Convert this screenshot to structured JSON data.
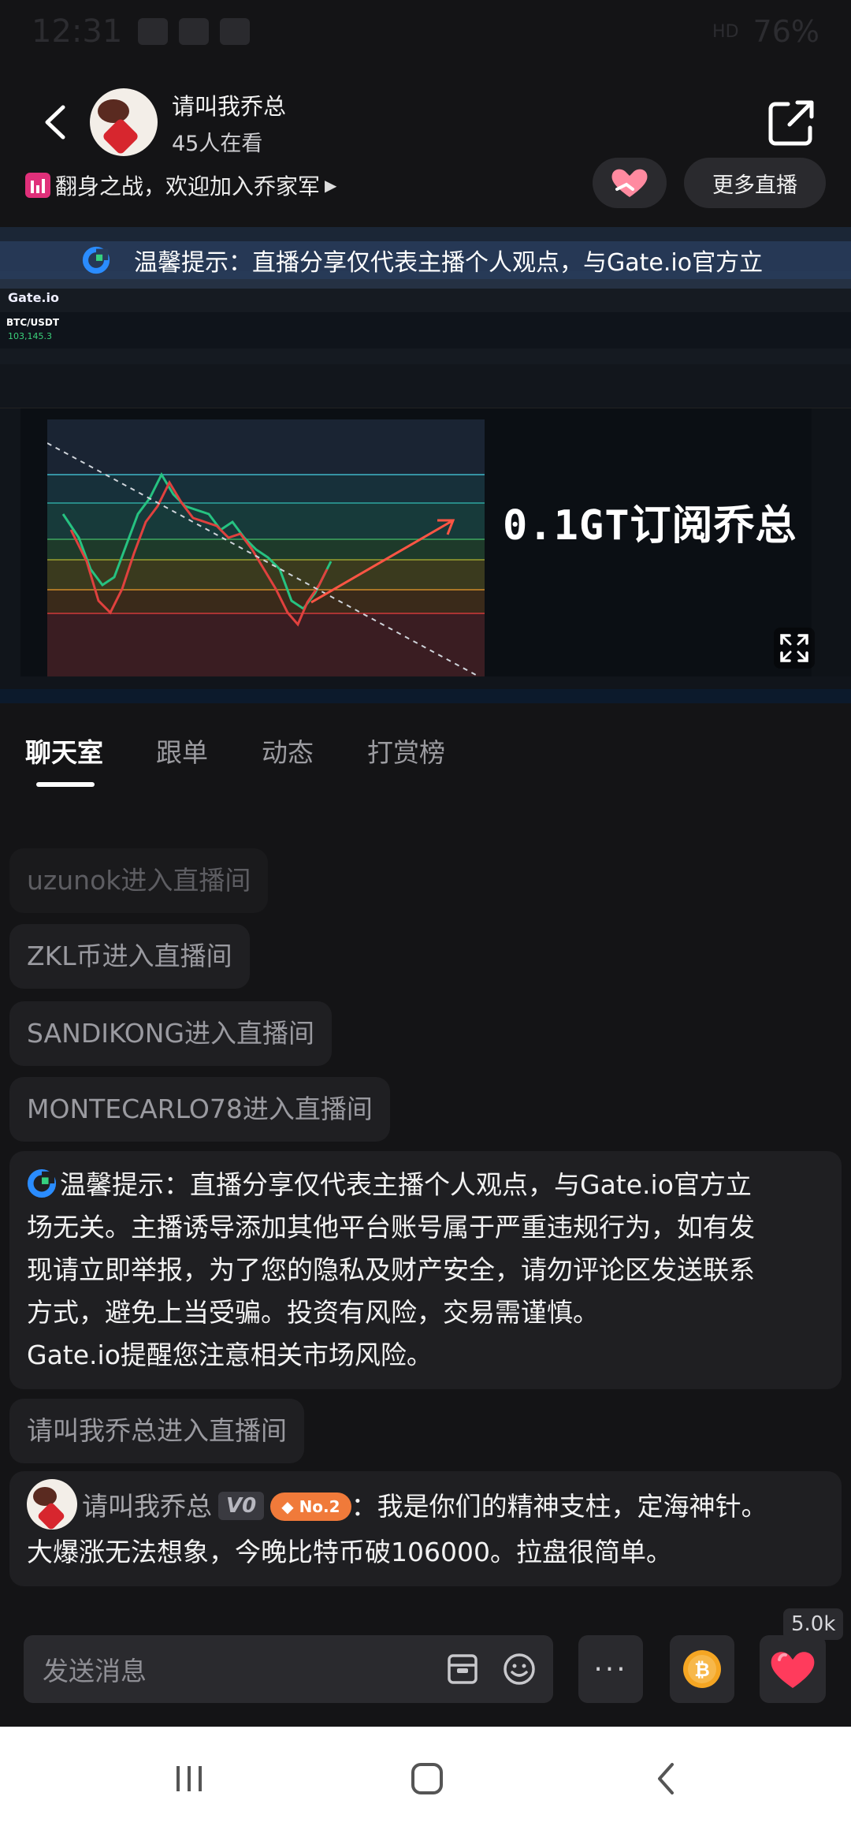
{
  "status_bar": {
    "time": "12:31",
    "battery": "76%",
    "network": "HD"
  },
  "header": {
    "host_name": "请叫我乔总",
    "viewers": "45人在看"
  },
  "promo": {
    "text": "翻身之战，欢迎加入乔家军",
    "more_live_label": "更多直播"
  },
  "video": {
    "notice_overlay": "温馨提示：直播分享仅代表主播个人观点，与Gate.io官方立",
    "overlay_text": "0.1GT订阅乔总",
    "logo": "Gate.io",
    "pair": "BTC/USDT",
    "price": "103,145.3"
  },
  "tabs": [
    {
      "label": "聊天室",
      "active": true
    },
    {
      "label": "跟单",
      "active": false
    },
    {
      "label": "动态",
      "active": false
    },
    {
      "label": "打赏榜",
      "active": false
    }
  ],
  "chat": {
    "enter_messages": [
      "uzunok进入直播间",
      "ZKL币进入直播间",
      "SANDIKONG进入直播间",
      "MONTECARLO78进入直播间"
    ],
    "notice": {
      "line1": "温馨提示：直播分享仅代表主播个人观点，与Gate.io官方立",
      "line2": "场无关。主播诱导添加其他平台账号属于严重违规行为，如有发",
      "line3": "现请立即举报，为了您的隐私及财产安全，请勿评论区发送联系",
      "line4": "方式，避免上当受骗。投资有风险，交易需谨慎。",
      "line5": "Gate.io提醒您注意相关市场风险。"
    },
    "host_enter": "请叫我乔总进入直播间",
    "message": {
      "user": "请叫我乔总",
      "level": "V0",
      "rank": "No.2",
      "line1": "：我是你们的精神支柱，定海神针。",
      "line2": "大爆涨无法想象，今晚比特币破106000。拉盘很简单。"
    }
  },
  "input": {
    "placeholder": "发送消息",
    "like_count": "5.0k",
    "more_label": "···"
  },
  "colors": {
    "background": "#141416",
    "bubble": "#1f1f22",
    "like": "#ff3b5c",
    "coin": "#f5a623"
  }
}
